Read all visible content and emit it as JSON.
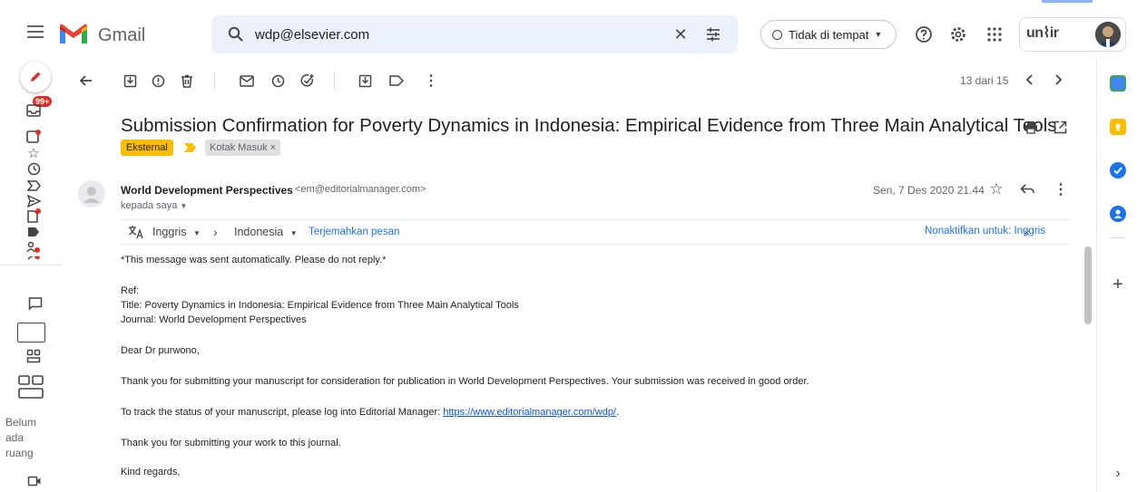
{
  "header": {
    "app_name": "Gmail",
    "search_value": "wdp@elsevier.com",
    "status_label": "Tidak di tempat",
    "org_logo_text": "un⌇ir"
  },
  "toolbar": {
    "page_count": "13 dari 15"
  },
  "rail": {
    "inbox_badge": "99+",
    "space_note": [
      "Belum",
      "ada",
      "ruang"
    ]
  },
  "email": {
    "subject": "Submission Confirmation for Poverty Dynamics in Indonesia: Empirical Evidence from Three Main Analytical Tools",
    "labels": {
      "external": "Eksternal",
      "inbox": "Kotak Masuk"
    },
    "sender_name": "World Development Perspectives",
    "sender_email": "<em@editorialmanager.com>",
    "recipient": "kepada saya",
    "date": "Sen, 7 Des 2020 21.44"
  },
  "translate": {
    "from": "Inggris",
    "to": "Indonesia",
    "action": "Terjemahkan pesan",
    "disable": "Nonaktifkan untuk: Inggris"
  },
  "body": {
    "notice": "*This message was sent automatically. Please do not reply.*",
    "ref": "Ref:",
    "title_line": "Title: Poverty Dynamics in Indonesia: Empirical Evidence from Three Main Analytical Tools",
    "journal_line": "Journal: World Development Perspectives",
    "greeting": "Dear Dr purwono,",
    "para1": "Thank you for submitting your manuscript for consideration for publication in World Development Perspectives. Your submission was received in good order.",
    "para2_prefix": "To track the status of your manuscript, please log into Editorial Manager: ",
    "para2_link": "https://www.editorialmanager.com/wdp/",
    "para2_suffix": ".",
    "para3": "Thank you for submitting your work to this journal.",
    "closing": "Kind regards,"
  },
  "colors": {
    "label_external": "#fbbc04",
    "link": "#1155cc",
    "accent_blue": "#1a73e8",
    "badge_red": "#d93025"
  }
}
